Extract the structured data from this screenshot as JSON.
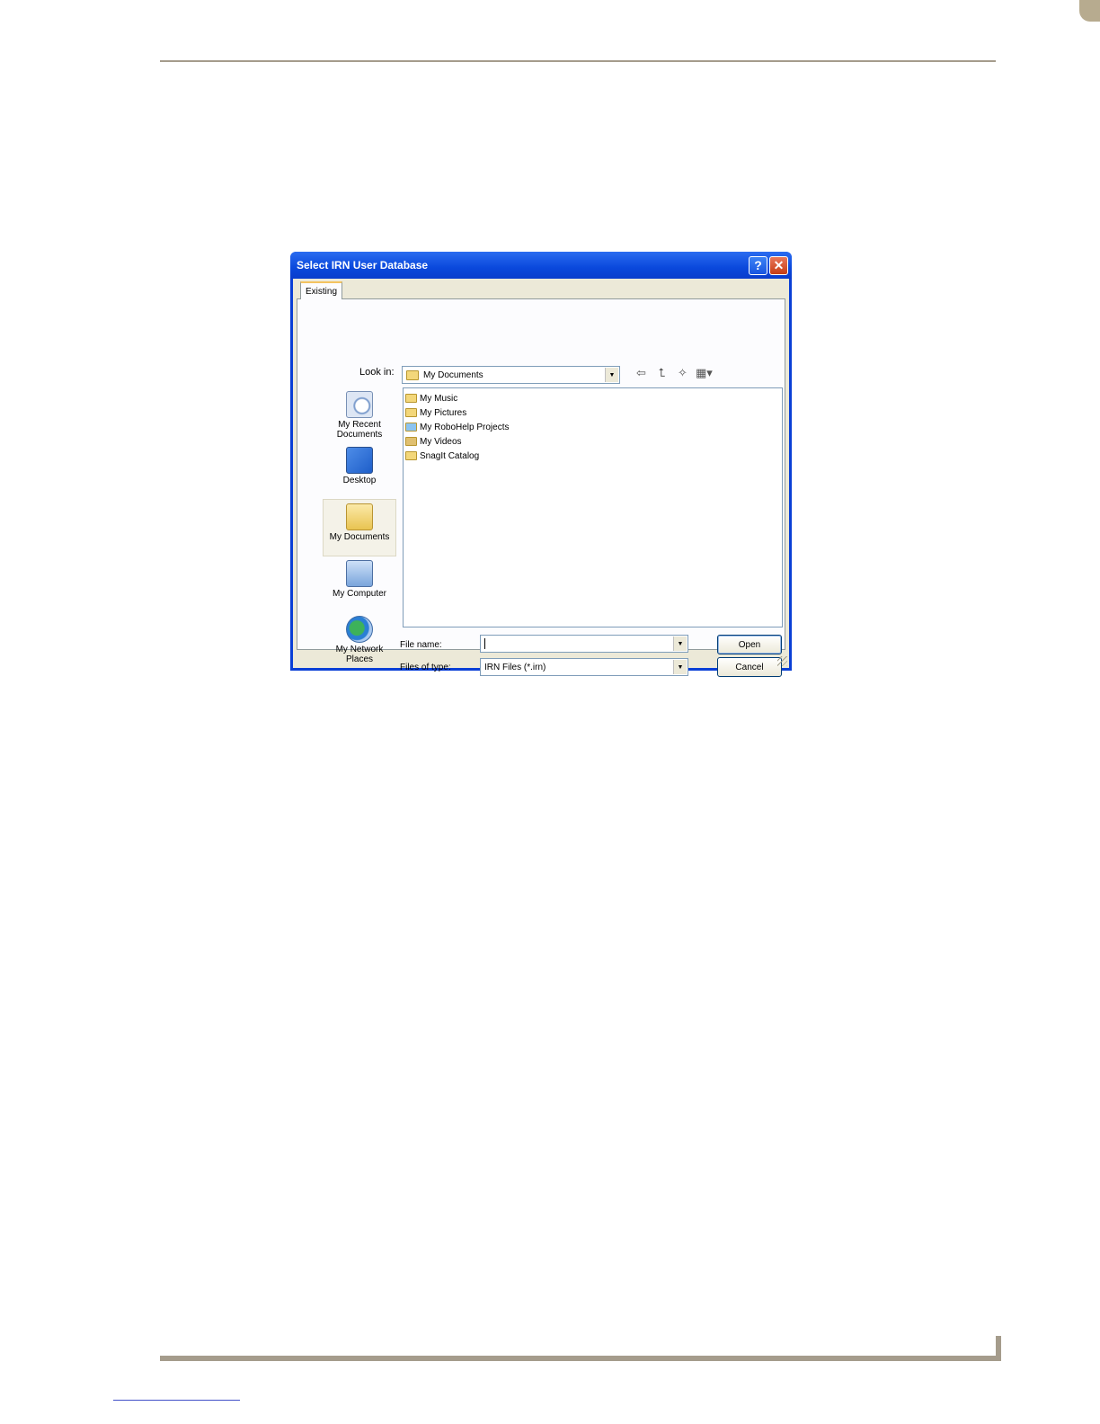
{
  "dialog": {
    "title": "Select IRN User Database",
    "help_glyph": "?",
    "close_glyph": "✕",
    "tab_label": "Existing",
    "look_in": {
      "label": "Look in:",
      "value": "My Documents",
      "arrow": "▼"
    },
    "toolbar": {
      "back_icon": "back-arrow-icon",
      "up_icon": "up-folder-icon",
      "new_folder_icon": "new-folder-icon",
      "views_icon": "views-menu-icon",
      "back_glyph": "⇦",
      "up_glyph": "⮤",
      "new_folder_glyph": "✧",
      "views_glyph": "▦▾"
    },
    "places": [
      {
        "label": "My Recent Documents",
        "icon": "recent-documents-icon"
      },
      {
        "label": "Desktop",
        "icon": "desktop-icon"
      },
      {
        "label": "My Documents",
        "icon": "my-documents-icon",
        "selected": true
      },
      {
        "label": "My Computer",
        "icon": "my-computer-icon"
      },
      {
        "label": "My Network Places",
        "icon": "network-places-icon"
      }
    ],
    "files": [
      {
        "name": "My Music",
        "icon": "music-folder-icon",
        "color": "#f3d77a"
      },
      {
        "name": "My Pictures",
        "icon": "pictures-folder-icon",
        "color": "#f3d77a"
      },
      {
        "name": "My RoboHelp Projects",
        "icon": "robohelp-folder-icon",
        "color": "#8cc4f0"
      },
      {
        "name": "My Videos",
        "icon": "videos-folder-icon",
        "color": "#e0c070"
      },
      {
        "name": "SnagIt Catalog",
        "icon": "folder-icon",
        "color": "#f3d77a"
      }
    ],
    "file_name": {
      "label": "File name:",
      "value": "",
      "arrow": "▼"
    },
    "file_type": {
      "label": "Files of type:",
      "value": "IRN Files (*.irn)",
      "arrow": "▼"
    },
    "buttons": {
      "open": "Open",
      "cancel": "Cancel"
    },
    "colors": {
      "titlebar": "#0a48dc",
      "client": "#ece9d8",
      "border": "#7f9db9"
    }
  }
}
